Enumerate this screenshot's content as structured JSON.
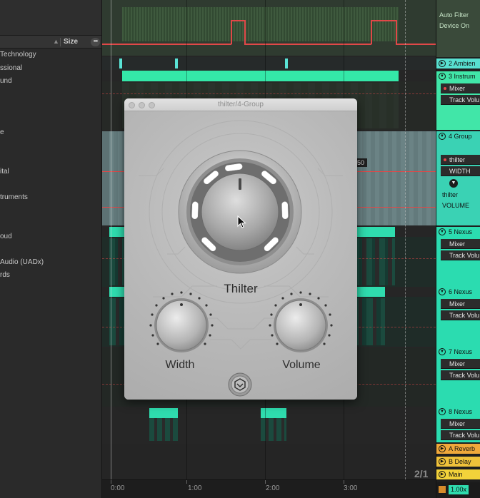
{
  "browser": {
    "column_header": "Size",
    "sort_glyph": "▲",
    "more_glyph": "•••",
    "items": [
      "Technology",
      "ssional",
      "und",
      "e",
      "ital",
      "truments",
      "oud",
      "Audio (UADx)",
      "rds"
    ]
  },
  "arrangement": {
    "ruler": [
      "0:00",
      "1:00",
      "2:00",
      "3:00"
    ],
    "page_indicator": "2/1",
    "value_readout": "50"
  },
  "plugin": {
    "window_title": "thilter/4-Group",
    "main_knob_label": "Thilter",
    "knob_left_label": "Width",
    "knob_right_label": "Volume"
  },
  "tracks_panel": {
    "top_device_lines": [
      "Auto Filter",
      "Device On"
    ],
    "tracks": [
      {
        "name": "2 Ambien",
        "color": "#58e0d0"
      },
      {
        "name": "3 Instrum",
        "color": "#41e6a8",
        "devices": [
          "Mixer",
          "Track Volu"
        ]
      },
      {
        "name": "4 Group",
        "color": "#3ad2b4",
        "devices": [
          "thilter",
          "WIDTH"
        ],
        "param_lines": [
          "thilter",
          "VOLUME"
        ]
      },
      {
        "name": "5 Nexus",
        "color": "#2bdcb0",
        "devices": [
          "Mixer",
          "Track Volu"
        ]
      },
      {
        "name": "6 Nexus",
        "color": "#2bdcb0",
        "devices": [
          "Mixer",
          "Track Volu"
        ]
      },
      {
        "name": "7 Nexus",
        "color": "#2bdcb0",
        "devices": [
          "Mixer",
          "Track Volu"
        ]
      },
      {
        "name": "8 Nexus",
        "color": "#2bdcb0",
        "devices": [
          "Mixer",
          "Track Volu"
        ]
      },
      {
        "name": "A Reverb",
        "color": "#f0a83a"
      },
      {
        "name": "B Delay",
        "color": "#f0c23a"
      },
      {
        "name": "Main",
        "color": "#f2d23a"
      }
    ],
    "tempo_readout": "1.00x"
  },
  "colors": {
    "accent_green": "#2ee8a8",
    "automation_red": "#e04848",
    "plugin_bg": "#b9b9b9"
  }
}
